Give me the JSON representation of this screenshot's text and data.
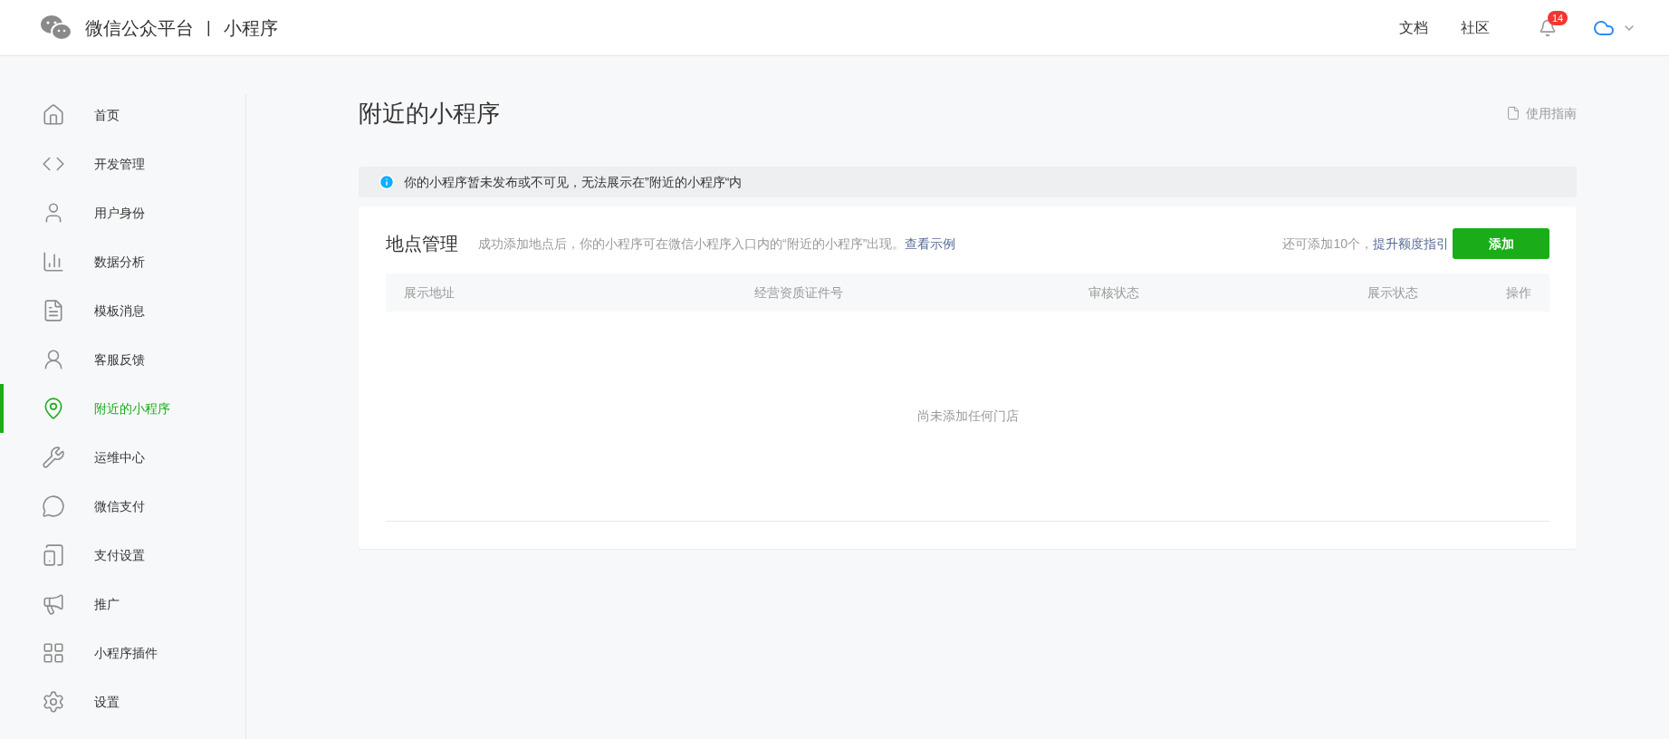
{
  "header": {
    "brand": "微信公众平台",
    "separator": "|",
    "product": "小程序",
    "links": [
      "文档",
      "社区"
    ],
    "notification_count": "14"
  },
  "sidebar": {
    "items": [
      {
        "label": "首页",
        "selected": false
      },
      {
        "label": "开发管理",
        "selected": false
      },
      {
        "label": "用户身份",
        "selected": false
      },
      {
        "label": "数据分析",
        "selected": false
      },
      {
        "label": "模板消息",
        "selected": false
      },
      {
        "label": "客服反馈",
        "selected": false
      },
      {
        "label": "附近的小程序",
        "selected": true
      },
      {
        "label": "运维中心",
        "selected": false
      },
      {
        "label": "微信支付",
        "selected": false
      },
      {
        "label": "支付设置",
        "selected": false
      },
      {
        "label": "推广",
        "selected": false
      },
      {
        "label": "小程序插件",
        "selected": false
      },
      {
        "label": "设置",
        "selected": false
      }
    ]
  },
  "page": {
    "title": "附近的小程序",
    "guide_link": "使用指南",
    "notice": "你的小程序暂未发布或不可见，无法展示在”附近的小程序“内"
  },
  "card": {
    "title": "地点管理",
    "description": "成功添加地点后，你的小程序可在微信小程序入口内的“附近的小程序”出现。",
    "example_link": "查看示例",
    "quota": "还可添加10个，",
    "quota_link": "提升额度指引",
    "add_button": "添加",
    "table": {
      "columns": [
        "展示地址",
        "经营资质证件号",
        "审核状态",
        "展示状态",
        "操作"
      ],
      "empty_text": "尚未添加任何门店"
    }
  }
}
